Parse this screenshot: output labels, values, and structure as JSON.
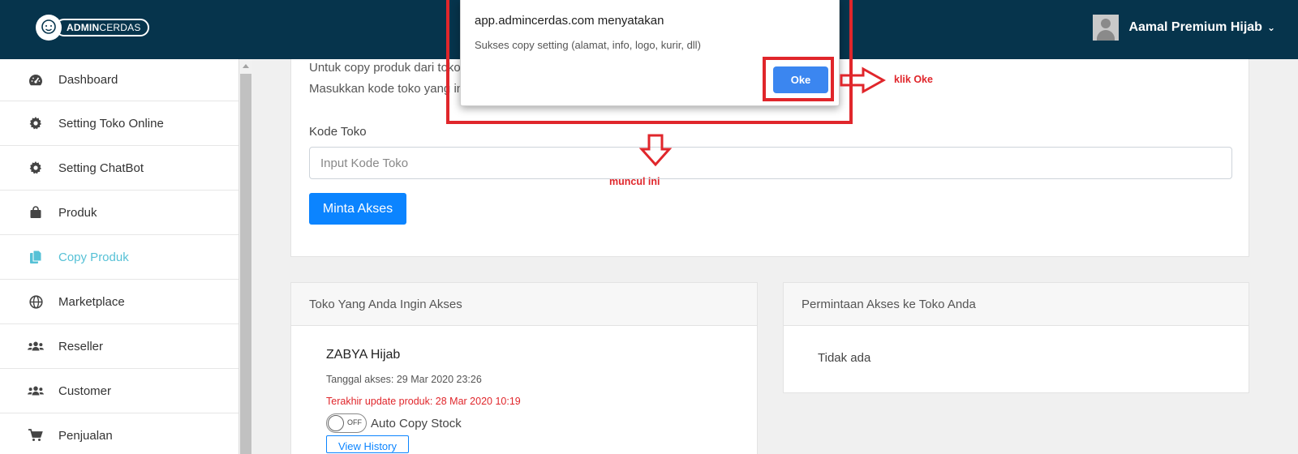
{
  "header": {
    "logo_text_bold": "ADMIN",
    "logo_text_rest": "CERDAS",
    "user_name": "Aamal Premium Hijab",
    "chevron": "⌄",
    "avatar_icon": "user-avatar-icon",
    "bg_color": "#06344c"
  },
  "sidebar": {
    "items": [
      {
        "label": "Dashboard",
        "icon": "dashboard-icon"
      },
      {
        "label": "Setting Toko Online",
        "icon": "gear-icon"
      },
      {
        "label": "Setting ChatBot",
        "icon": "gear-icon"
      },
      {
        "label": "Produk",
        "icon": "shopping-bag-icon"
      },
      {
        "label": "Copy Produk",
        "icon": "copy-icon",
        "active": true
      },
      {
        "label": "Marketplace",
        "icon": "globe-icon"
      },
      {
        "label": "Reseller",
        "icon": "users-icon"
      },
      {
        "label": "Customer",
        "icon": "users-icon"
      },
      {
        "label": "Penjualan",
        "icon": "cart-icon"
      }
    ],
    "active_color": "#56c1d6"
  },
  "main": {
    "desc_line1": "Untuk copy produk dari toko lain, toko tersebut harus menyetujui untuk memberikan akses.",
    "desc_line2": "Masukkan kode toko yang ingin Anda akses",
    "kode_label": "Kode Toko",
    "kode_placeholder": "Input Kode Toko",
    "request_button": "Minta Akses",
    "left_card": {
      "title": "Toko Yang Anda Ingin Akses",
      "shop_name": "ZABYA Hijab",
      "access_date": "Tanggal akses: 29 Mar 2020 23:26",
      "last_update": "Terakhir update produk: 28 Mar 2020 10:19",
      "toggle_state": "OFF",
      "toggle_label": "Auto Copy Stock",
      "history_button": "View History"
    },
    "right_card": {
      "title": "Permintaan Akses ke Toko Anda",
      "empty_text": "Tidak ada"
    },
    "primary_color": "#0b84ff"
  },
  "dialog": {
    "title": "app.admincerdas.com menyatakan",
    "message": "Sukses copy setting (alamat, info, logo, kurir, dll)",
    "ok_label": "Oke"
  },
  "annotations": {
    "click_ok": "klik Oke",
    "appears": "muncul ini",
    "color": "#e0262b"
  }
}
